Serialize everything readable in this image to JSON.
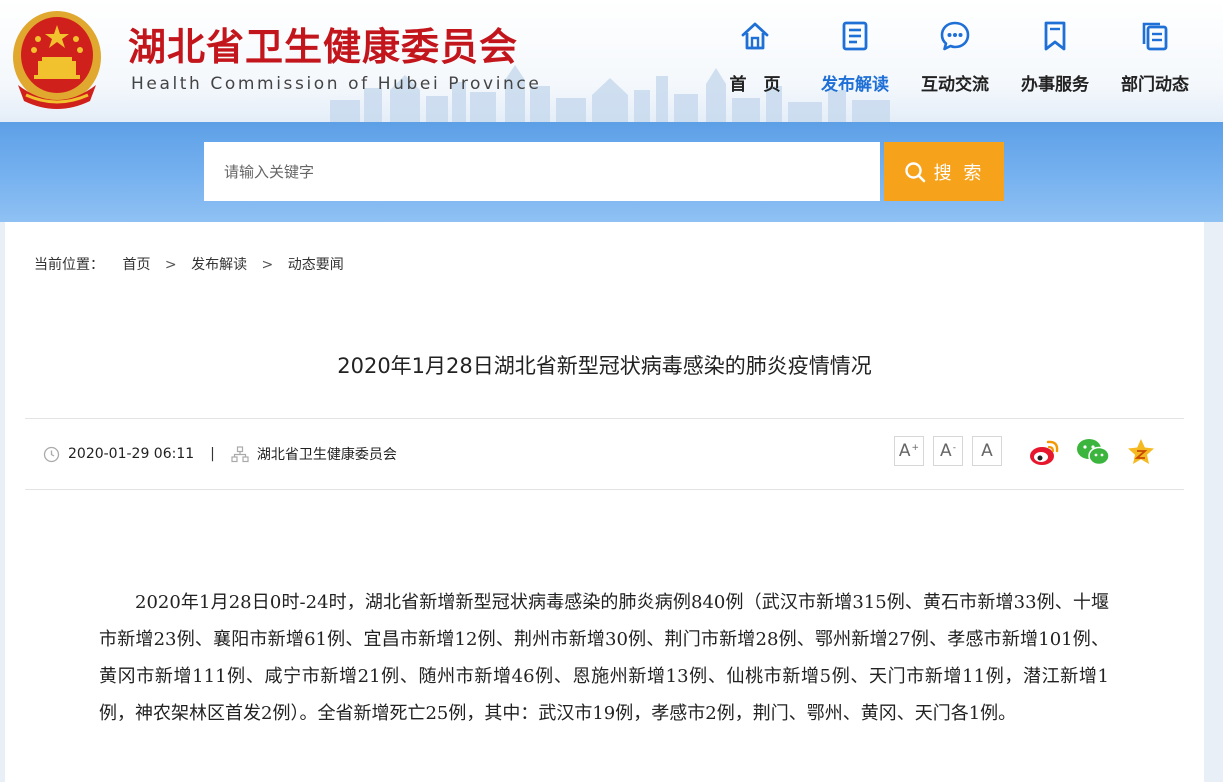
{
  "site": {
    "title": "湖北省卫生健康委员会",
    "subtitle": "Health Commission of Hubei Province"
  },
  "nav": [
    {
      "label": "首　页",
      "icon": "home-icon"
    },
    {
      "label": "发布解读",
      "icon": "document-icon",
      "active": true
    },
    {
      "label": "互动交流",
      "icon": "chat-bubble-icon"
    },
    {
      "label": "办事服务",
      "icon": "bookmark-icon"
    },
    {
      "label": "部门动态",
      "icon": "copy-pages-icon"
    }
  ],
  "search": {
    "placeholder": "请输入关键字",
    "button_label": "搜 索"
  },
  "breadcrumb": {
    "label": "当前位置：",
    "items": [
      "首页",
      "发布解读",
      "动态要闻"
    ],
    "separator": ">"
  },
  "article": {
    "title": "2020年1月28日湖北省新型冠状病毒感染的肺炎疫情情况",
    "date": "2020-01-29 06:11",
    "meta_separator": "|",
    "source": "湖北省卫生健康委员会",
    "body": "2020年1月28日0时-24时，湖北省新增新型冠状病毒感染的肺炎病例840例（武汉市新增315例、黄石市新增33例、十堰市新增23例、襄阳市新增61例、宜昌市新增12例、荆州市新增30例、荆门市新增28例、鄂州新增27例、孝感市新增101例、黄冈市新增111例、咸宁市新增21例、随州市新增46例、恩施州新增13例、仙桃市新增5例、天门市新增11例，潜江新增1例，神农架林区首发2例）。全省新增死亡25例，其中：武汉市19例，孝感市2例，荆门、鄂州、黄冈、天门各1例。"
  },
  "font_size_controls": {
    "increase": "A",
    "increase_mark": "+",
    "decrease": "A",
    "decrease_mark": "-",
    "reset": "A"
  },
  "share_icons": [
    "weibo-icon",
    "wechat-icon",
    "favorite-star-icon"
  ],
  "colors": {
    "brand_red": "#c3161c",
    "accent_blue": "#1e6fd6",
    "search_orange": "#f7a21b"
  }
}
